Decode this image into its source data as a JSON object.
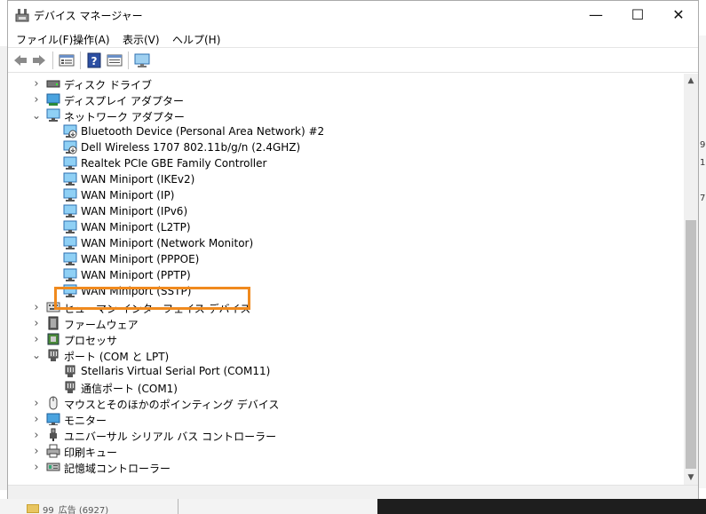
{
  "window": {
    "title": "デバイス マネージャー",
    "controls": {
      "minimize": "—",
      "maximize": "☐",
      "close": "✕"
    }
  },
  "menu": [
    "ファイル(F)",
    "操作(A)",
    "表示(V)",
    "ヘルプ(H)"
  ],
  "toolbar": {
    "buttons": [
      "back-arrow-icon",
      "forward-arrow-icon",
      "properties-icon",
      "help-icon",
      "view-icon",
      "monitor-scan-icon"
    ]
  },
  "tree": [
    {
      "label": "ディスク ドライブ",
      "level": 0,
      "expanded": false,
      "icon": "disk-drive-icon"
    },
    {
      "label": "ディスプレイ アダプター",
      "level": 0,
      "expanded": false,
      "icon": "display-adapter-icon"
    },
    {
      "label": "ネットワーク アダプター",
      "level": 0,
      "expanded": true,
      "icon": "network-adapter-icon"
    },
    {
      "label": "Bluetooth Device (Personal Area Network) #2",
      "level": 1,
      "icon": "network-device-disabled-icon"
    },
    {
      "label": "Dell Wireless 1707 802.11b/g/n (2.4GHZ)",
      "level": 1,
      "icon": "network-device-disabled-icon"
    },
    {
      "label": "Realtek PCIe GBE Family Controller",
      "level": 1,
      "icon": "network-device-icon"
    },
    {
      "label": "WAN Miniport (IKEv2)",
      "level": 1,
      "icon": "network-device-icon"
    },
    {
      "label": "WAN Miniport (IP)",
      "level": 1,
      "icon": "network-device-icon"
    },
    {
      "label": "WAN Miniport (IPv6)",
      "level": 1,
      "icon": "network-device-icon"
    },
    {
      "label": "WAN Miniport (L2TP)",
      "level": 1,
      "icon": "network-device-icon"
    },
    {
      "label": "WAN Miniport (Network Monitor)",
      "level": 1,
      "icon": "network-device-icon"
    },
    {
      "label": "WAN Miniport (PPPOE)",
      "level": 1,
      "icon": "network-device-icon"
    },
    {
      "label": "WAN Miniport (PPTP)",
      "level": 1,
      "icon": "network-device-icon"
    },
    {
      "label": "WAN Miniport (SSTP)",
      "level": 1,
      "icon": "network-device-icon"
    },
    {
      "label": "ヒューマン インターフェイス デバイス",
      "level": 0,
      "expanded": false,
      "icon": "hid-icon"
    },
    {
      "label": "ファームウェア",
      "level": 0,
      "expanded": false,
      "icon": "firmware-icon"
    },
    {
      "label": "プロセッサ",
      "level": 0,
      "expanded": false,
      "icon": "processor-icon"
    },
    {
      "label": "ポート (COM と LPT)",
      "level": 0,
      "expanded": true,
      "icon": "port-icon"
    },
    {
      "label": "Stellaris Virtual Serial Port (COM11)",
      "level": 1,
      "icon": "port-device-icon",
      "highlighted": true
    },
    {
      "label": "通信ポート (COM1)",
      "level": 1,
      "icon": "port-device-icon"
    },
    {
      "label": "マウスとそのほかのポインティング デバイス",
      "level": 0,
      "expanded": false,
      "icon": "mouse-icon"
    },
    {
      "label": "モニター",
      "level": 0,
      "expanded": false,
      "icon": "monitor-icon"
    },
    {
      "label": "ユニバーサル シリアル バス コントローラー",
      "level": 0,
      "expanded": false,
      "icon": "usb-icon"
    },
    {
      "label": "印刷キュー",
      "level": 0,
      "expanded": false,
      "icon": "printer-icon"
    },
    {
      "label": "記憶域コントローラー",
      "level": 0,
      "expanded": false,
      "icon": "storage-controller-icon"
    }
  ],
  "background": {
    "right_edge_text": [
      "9",
      "1",
      "7"
    ],
    "bottom_text": "99_広告 (6927)"
  },
  "colors": {
    "highlight_border": "#f08a1e",
    "network_icon": "#3a8fd6"
  }
}
